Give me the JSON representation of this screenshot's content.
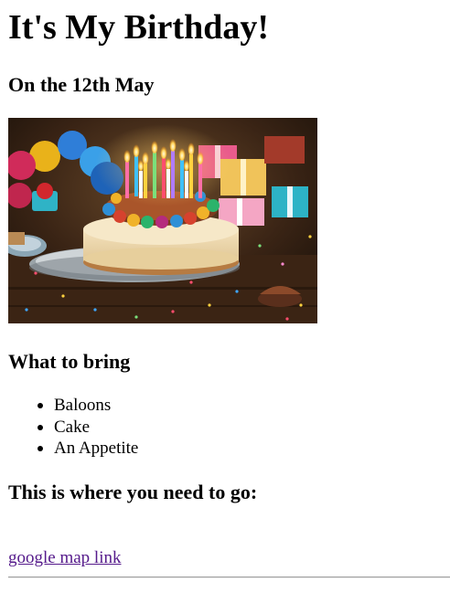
{
  "page": {
    "title": "It's My Birthday!",
    "date_heading": "On the 12th May",
    "image": {
      "subject": "birthday-cake-with-candles"
    },
    "bring_heading": "What to bring",
    "bring_items": [
      "Baloons",
      "Cake",
      "An Appetite"
    ],
    "location_heading": "This is where you need to go:",
    "map_link_text": "google map link"
  },
  "colors": {
    "link_visited": "#551a8b",
    "text": "#000000",
    "background": "#ffffff",
    "rule": "#a0a0a0"
  }
}
